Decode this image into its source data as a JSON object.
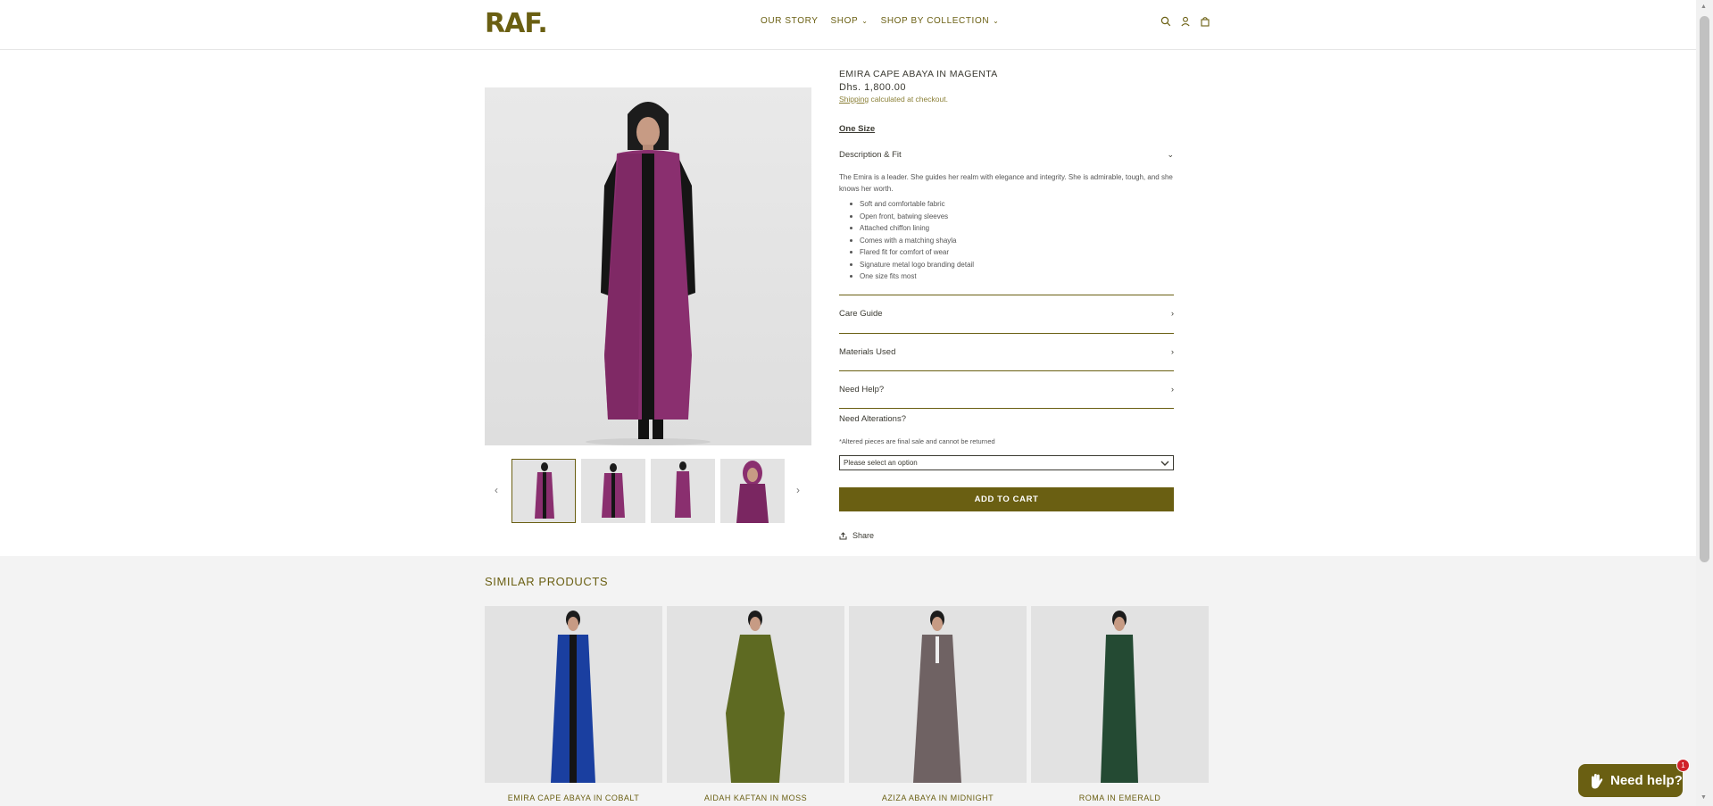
{
  "brand": {
    "logo": "RAF.",
    "accent": "#6a5f12"
  },
  "nav": {
    "our_story": "OUR STORY",
    "shop": "SHOP",
    "shop_by_collection": "SHOP BY COLLECTION"
  },
  "header_icons": [
    "search-icon",
    "account-icon",
    "cart-icon"
  ],
  "product": {
    "title": "EMIRA CAPE ABAYA IN MAGENTA",
    "price": "Dhs. 1,800.00",
    "shipping_link": "Shipping",
    "shipping_text": " calculated at checkout.",
    "size": "One Size",
    "description_heading": "Description & Fit",
    "description": "The Emira is a leader. She guides her realm with elegance and integrity. She is admirable, tough, and she knows her worth.",
    "features": [
      "Soft and comfortable fabric",
      "Open front, batwing sleeves",
      "Attached chiffon lining",
      "Comes with a matching shayla",
      "Flared fit for comfort of wear",
      "Signature metal logo branding detail",
      "One size fits most"
    ],
    "care_heading": "Care Guide",
    "materials_heading": "Materials Used",
    "help_heading": "Need Help?",
    "alterations_heading": "Need Alterations?",
    "alterations_note": "*Altered pieces are final sale and cannot be returned",
    "select_placeholder": "Please select an option",
    "add_to_cart": "ADD TO CART",
    "share": "Share",
    "color": "#8a2f6f"
  },
  "similar": {
    "title": "SIMILAR PRODUCTS",
    "items": [
      {
        "name": "EMIRA CAPE ABAYA IN COBALT",
        "color": "#1a3fa0"
      },
      {
        "name": "AIDAH KAFTAN IN MOSS",
        "color": "#5e6a22"
      },
      {
        "name": "AZIZA ABAYA IN MIDNIGHT",
        "color": "#6f6263"
      },
      {
        "name": "ROMA IN EMERALD",
        "color": "#244a33"
      }
    ]
  },
  "chat": {
    "label": "Need help?",
    "badge": "1"
  }
}
